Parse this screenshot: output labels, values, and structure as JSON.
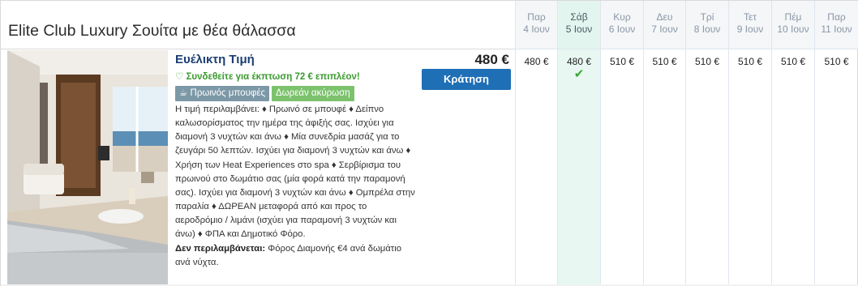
{
  "room": {
    "title": "Elite Club Luxury Σουίτα με θέα θάλασσα"
  },
  "rate": {
    "name": "Ευέλικτη Τιμή",
    "promo_icon": "heart-outline-icon",
    "promo": "Συνδεθείτε για έκπτωση 72 € επιπλέον!",
    "badge_breakfast_icon": "breakfast-icon",
    "badge_breakfast": "Πρωινός μπουφές",
    "badge_cancel": "Δωρεάν ακύρωση",
    "description": "Η τιμή περιλαμβάνει: ♦ Πρωινό σε μπουφέ ♦ Δείπνο καλωσορίσματος την ημέρα της άφιξής σας. Ισχύει για διαμονή 3 νυχτών και άνω ♦ Μία συνεδρία μασάζ για το ζευγάρι 50 λεπτών. Ισχύει για διαμονή 3 νυχτών και άνω ♦ Χρήση των Heat Experiences στο spa ♦ Σερβίρισμα του πρωινού στο δωμάτιο σας (μία φορά κατά την παραμονή σας). Ισχύει για διαμονή 3 νυχτών και άνω ♦ Ομπρέλα στην παραλία ♦ ΔΩΡΕΑΝ μεταφορά από και προς το αεροδρόμιο / λιμάνι (ισχύει για παραμονή 3 νυχτών και άνω) ♦ ΦΠΑ και Δημοτικό Φόρο.",
    "excluded_label": "Δεν περιλαμβάνεται:",
    "excluded_text": " Φόρος Διαμονής €4 ανά δωμάτιο ανά νύχτα.",
    "price": "480 €",
    "book_label": "Κράτηση"
  },
  "days": [
    {
      "name": "Παρ",
      "date": "4 Ιουν",
      "price": "480 €",
      "selected": false
    },
    {
      "name": "Σάβ",
      "date": "5 Ιουν",
      "price": "480 €",
      "selected": true,
      "check": "✔"
    },
    {
      "name": "Κυρ",
      "date": "6 Ιουν",
      "price": "510 €",
      "selected": false
    },
    {
      "name": "Δευ",
      "date": "7 Ιουν",
      "price": "510 €",
      "selected": false
    },
    {
      "name": "Τρί",
      "date": "8 Ιουν",
      "price": "510 €",
      "selected": false
    },
    {
      "name": "Τετ",
      "date": "9 Ιουν",
      "price": "510 €",
      "selected": false
    },
    {
      "name": "Πέμ",
      "date": "10 Ιουν",
      "price": "510 €",
      "selected": false
    },
    {
      "name": "Παρ",
      "date": "11 Ιουν",
      "price": "510 €",
      "selected": false
    }
  ],
  "colors": {
    "brand_blue": "#1f6fb6",
    "rate_name": "#1c3e72",
    "promo_green": "#3b9a2f",
    "selected_day_bg": "#e2f5ee",
    "check_green": "#3aa63a"
  }
}
